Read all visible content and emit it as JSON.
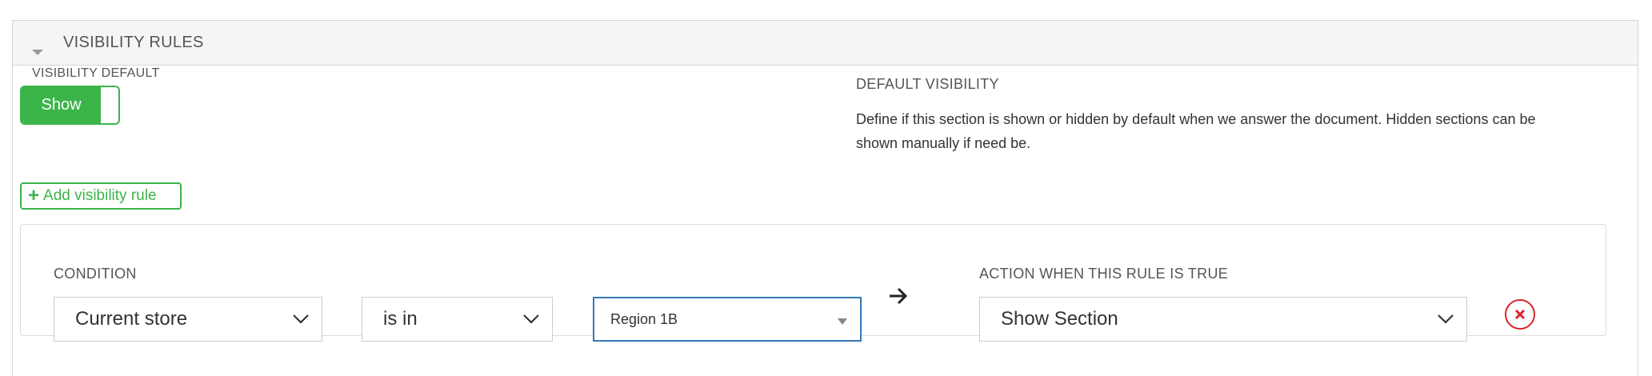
{
  "panel": {
    "title": "VISIBILITY RULES"
  },
  "visibility_default": {
    "label": "VISIBILITY DEFAULT",
    "toggle_value": "Show"
  },
  "default_visibility_help": {
    "title": "DEFAULT VISIBILITY",
    "description": "Define if this section is shown or hidden by default when we answer the document. Hidden sections can be shown manually if need be."
  },
  "add_rule_button": "Add visibility rule",
  "rule": {
    "condition_label": "CONDITION",
    "field_value": "Current store",
    "operator_value": "is in",
    "value_value": "Region 1B",
    "action_label": "ACTION WHEN THIS RULE IS TRUE",
    "action_value": "Show Section"
  },
  "colors": {
    "accent_green": "#3bb54a",
    "focus_blue": "#337ab7",
    "danger_red": "#d9232e"
  },
  "icons": {
    "collapse": "caret-down-icon",
    "add": "plus-icon",
    "dropdown": "chevron-down-icon",
    "arrow": "arrow-right-icon",
    "remove": "remove-circle-icon"
  }
}
